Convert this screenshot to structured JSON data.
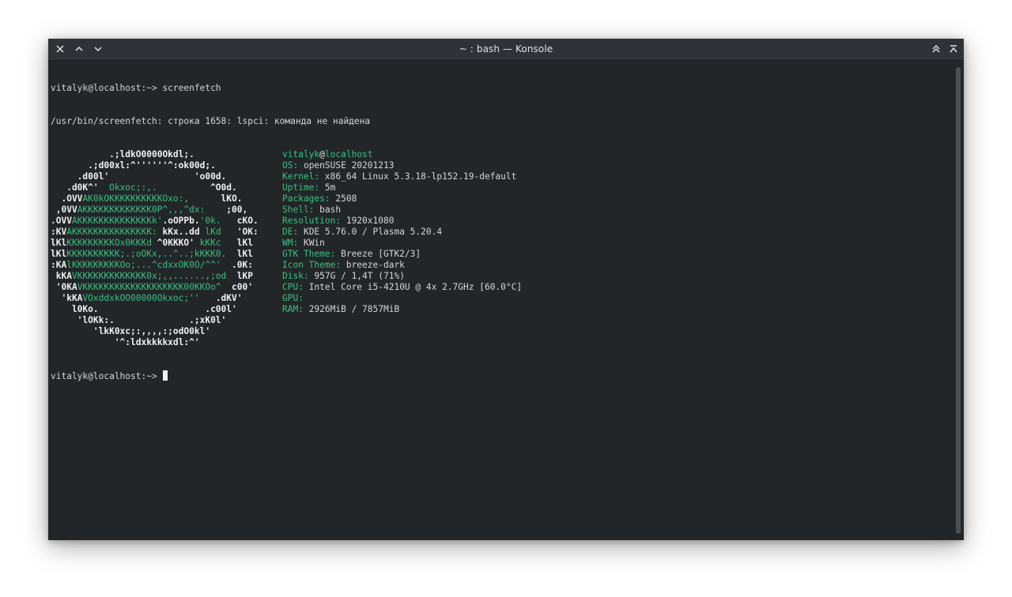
{
  "window": {
    "title": "~ : bash — Konsole"
  },
  "terminal": {
    "command_line": "vitalyk@localhost:~> screenfetch",
    "error_line": "/usr/bin/screenfetch: строка 1658: lspci: команда не найдена",
    "prompt": "vitalyk@localhost:~> ",
    "logo": [
      [
        {
          "t": "           .;ldkO0000Okdl;.",
          "c": "w"
        }
      ],
      [
        {
          "t": "       .;d00xl:^''''''^:ok00d;.",
          "c": "w"
        }
      ],
      [
        {
          "t": "     .d00l'                'o00d.",
          "c": "w"
        }
      ],
      [
        {
          "t": "   .d0K^'  ",
          "c": "w"
        },
        {
          "t": "Okxoc;:,.",
          "c": "g"
        },
        {
          "t": "          ^O0d.",
          "c": "w"
        }
      ],
      [
        {
          "t": "  .OVV",
          "c": "w"
        },
        {
          "t": "AK0kOKKKKKKKKKKOxo:,",
          "c": "g"
        },
        {
          "t": "      lKO.",
          "c": "w"
        }
      ],
      [
        {
          "t": " ,0VV",
          "c": "w"
        },
        {
          "t": "AKKKKKKKKKKKKK0P^,,,^dx:",
          "c": "g"
        },
        {
          "t": "    ;00,",
          "c": "w"
        }
      ],
      [
        {
          "t": ".OVV",
          "c": "w"
        },
        {
          "t": "AKKKKKKKKKKKKKKk'",
          "c": "g"
        },
        {
          "t": ".oOPPb.",
          "c": "w"
        },
        {
          "t": "'0k.",
          "c": "g"
        },
        {
          "t": "   cKO.",
          "c": "w"
        }
      ],
      [
        {
          "t": ":KV",
          "c": "w"
        },
        {
          "t": "AKKKKKKKKKKKKKKK: ",
          "c": "g"
        },
        {
          "t": "kKx..dd ",
          "c": "w"
        },
        {
          "t": "lKd",
          "c": "g"
        },
        {
          "t": "   'OK:",
          "c": "w"
        }
      ],
      [
        {
          "t": "lKl",
          "c": "w"
        },
        {
          "t": "KKKKKKKKKOx0KKKd ",
          "c": "g"
        },
        {
          "t": "^0KKKO' ",
          "c": "w"
        },
        {
          "t": "kKKc",
          "c": "g"
        },
        {
          "t": "   lKl",
          "c": "w"
        }
      ],
      [
        {
          "t": "lKl",
          "c": "w"
        },
        {
          "t": "KKKKKKKKKK;.;oOKx,..^..;kKKK0.",
          "c": "g"
        },
        {
          "t": "  lKl",
          "c": "w"
        }
      ],
      [
        {
          "t": ":KA",
          "c": "w"
        },
        {
          "t": "lKKKKKKKKKOo;...^cdxxOK0O/^^'",
          "c": "g"
        },
        {
          "t": "  .0K:",
          "c": "w"
        }
      ],
      [
        {
          "t": " kKA",
          "c": "w"
        },
        {
          "t": "VKKKKKKKKKKKKK0x;,,......,;od",
          "c": "g"
        },
        {
          "t": "  lKP",
          "c": "w"
        }
      ],
      [
        {
          "t": " '0KA",
          "c": "w"
        },
        {
          "t": "VKKKKKKKKKKKKKKKKKKK00KKOo^",
          "c": "g"
        },
        {
          "t": "  c00'",
          "c": "w"
        }
      ],
      [
        {
          "t": "  'kKA",
          "c": "w"
        },
        {
          "t": "VOxddxkOO00000Okxoc;''",
          "c": "g"
        },
        {
          "t": "   .dKV'",
          "c": "w"
        }
      ],
      [
        {
          "t": "    l0Ko.                    .c00l'",
          "c": "w"
        }
      ],
      [
        {
          "t": "     'lOKk:.              .;xK0l'",
          "c": "w"
        }
      ],
      [
        {
          "t": "        'lkK0xc;:,,,,:;odO0kl'",
          "c": "w"
        }
      ],
      [
        {
          "t": "            '^:ldxkkkkxdl:^'",
          "c": "w"
        }
      ]
    ],
    "info": [
      {
        "user": "vitalyk",
        "at": "@",
        "host": "localhost"
      },
      {
        "label": "OS: ",
        "value": "openSUSE 20201213"
      },
      {
        "label": "Kernel: ",
        "value": "x86_64 Linux 5.3.18-lp152.19-default"
      },
      {
        "label": "Uptime: ",
        "value": "5m"
      },
      {
        "label": "Packages: ",
        "value": "2508"
      },
      {
        "label": "Shell: ",
        "value": "bash"
      },
      {
        "label": "Resolution: ",
        "value": "1920x1080"
      },
      {
        "label": "DE: ",
        "value": "KDE 5.76.0 / Plasma 5.20.4"
      },
      {
        "label": "WM: ",
        "value": "KWin"
      },
      {
        "label": "GTK Theme: ",
        "value": "Breeze [GTK2/3]"
      },
      {
        "label": "Icon Theme: ",
        "value": "breeze-dark"
      },
      {
        "label": "Disk: ",
        "value": "957G / 1,4T (71%)"
      },
      {
        "label": "CPU: ",
        "value": "Intel Core i5-4210U @ 4x 2.7GHz [60.0°C]"
      },
      {
        "label": "GPU: ",
        "value": ""
      },
      {
        "label": "RAM: ",
        "value": "2926MiB / 7857MiB"
      }
    ]
  },
  "colors": {
    "accent_green": "#35c27f",
    "background": "#232629",
    "titlebar": "#2f3337"
  }
}
